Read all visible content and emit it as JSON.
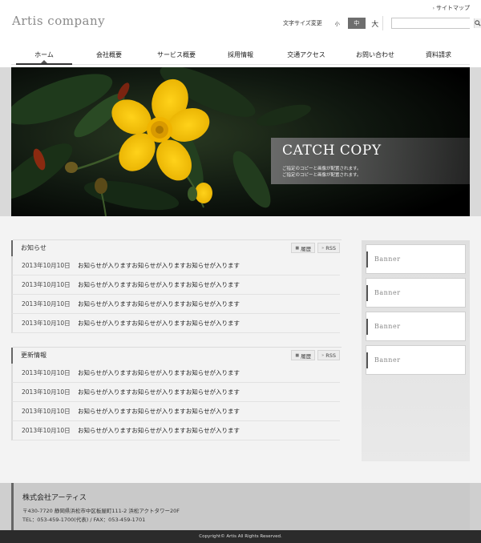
{
  "header": {
    "logo": "Artis company",
    "sitemap_label": "サイトマップ",
    "fontsize_label": "文字サイズ変更",
    "fontsize_options": [
      "小",
      "中",
      "大"
    ],
    "fontsize_selected": "中",
    "search_placeholder": ""
  },
  "nav": {
    "items": [
      "ホーム",
      "会社概要",
      "サービス概要",
      "採用情報",
      "交通アクセス",
      "お問い合わせ",
      "資料請求"
    ],
    "active": "ホーム"
  },
  "hero": {
    "catch_title": "CATCH COPY",
    "catch_line1": "ご指定のコピーと画像が配置されます。",
    "catch_line2": "ご指定のコピーと画像が配置されます。"
  },
  "news": {
    "title": "お知らせ",
    "history_label": "履歴",
    "rss_label": "RSS",
    "rows": [
      {
        "date": "2013年10月10日",
        "text": "お知らせが入りますお知らせが入りますお知らせが入ります"
      },
      {
        "date": "2013年10月10日",
        "text": "お知らせが入りますお知らせが入りますお知らせが入ります"
      },
      {
        "date": "2013年10月10日",
        "text": "お知らせが入りますお知らせが入りますお知らせが入ります"
      },
      {
        "date": "2013年10月10日",
        "text": "お知らせが入りますお知らせが入りますお知らせが入ります"
      }
    ]
  },
  "updates": {
    "title": "更新情報",
    "history_label": "履歴",
    "rss_label": "RSS",
    "rows": [
      {
        "date": "2013年10月10日",
        "text": "お知らせが入りますお知らせが入りますお知らせが入ります"
      },
      {
        "date": "2013年10月10日",
        "text": "お知らせが入りますお知らせが入りますお知らせが入ります"
      },
      {
        "date": "2013年10月10日",
        "text": "お知らせが入りますお知らせが入りますお知らせが入ります"
      },
      {
        "date": "2013年10月10日",
        "text": "お知らせが入りますお知らせが入りますお知らせが入ります"
      }
    ]
  },
  "sidebar": {
    "banners": [
      "Banner",
      "Banner",
      "Banner",
      "Banner"
    ]
  },
  "footer": {
    "company_name": "株式会社アーティス",
    "address": "〒430-7720 静岡県浜松市中区板屋町111-2 浜松アクトタワー20F",
    "tel": "TEL：053-459-1700(代表) / FAX：053-459-1701",
    "copyright": "Copyright© Artis All Rights Reserved."
  },
  "colors": {
    "nav_active": "#333333",
    "fontsize_selected_bg": "#6e6e6e",
    "footer_bg": "#c9c9c9",
    "copyright_bg": "#2b2b2b",
    "flower": "#f5c400"
  }
}
